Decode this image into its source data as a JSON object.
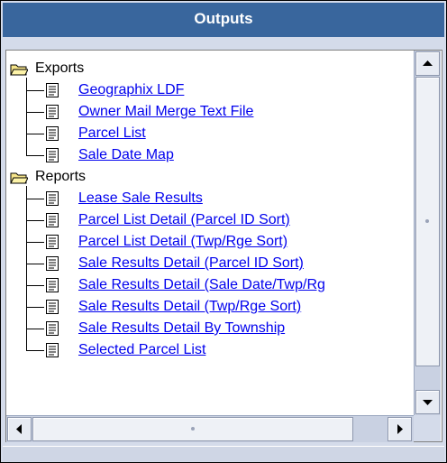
{
  "panel": {
    "title": "Outputs"
  },
  "tree": {
    "folders": [
      {
        "label": "Exports",
        "items": [
          "Geographix LDF",
          "Owner Mail Merge Text File",
          "Parcel List",
          "Sale Date Map"
        ]
      },
      {
        "label": "Reports",
        "items": [
          "Lease Sale Results",
          "Parcel List Detail (Parcel ID Sort)",
          "Parcel List Detail (Twp/Rge Sort)",
          "Sale Results Detail (Parcel ID Sort)",
          "Sale Results Detail (Sale Date/Twp/Rg",
          "Sale Results Detail (Twp/Rge Sort)",
          "Sale Results Detail By Township",
          "Selected Parcel List"
        ]
      }
    ]
  },
  "icons": {
    "folder": "folder-open-icon",
    "document": "document-icon",
    "scroll_up": "arrow-up-icon",
    "scroll_down": "arrow-down-icon",
    "scroll_left": "arrow-left-icon",
    "scroll_right": "arrow-right-icon"
  },
  "colors": {
    "title_bar": "#39669d",
    "title_text": "#ffffff",
    "link": "#0000ee",
    "panel_bg": "#d4dbea"
  }
}
